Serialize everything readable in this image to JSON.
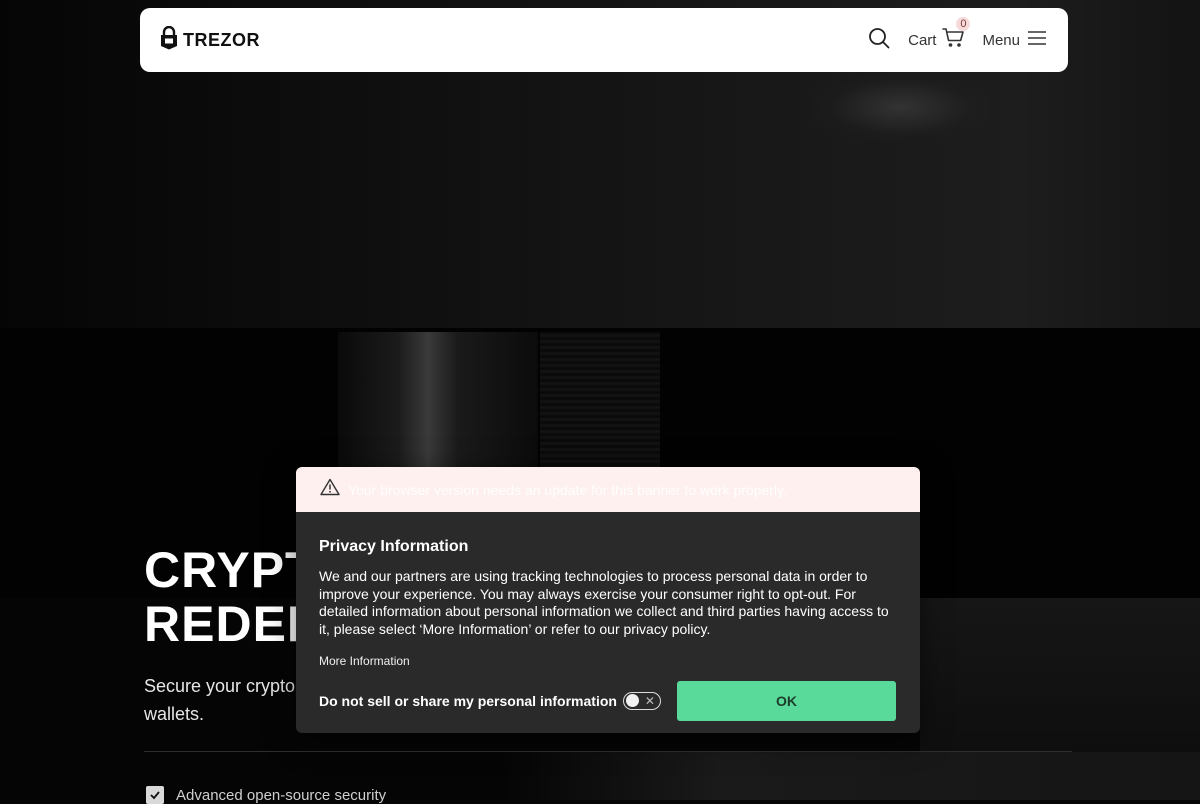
{
  "header": {
    "logo_text": "TREZOR",
    "cart_label": "Cart",
    "cart_count": "0",
    "menu_label": "Menu"
  },
  "hero": {
    "title_line1": "CRYPT",
    "title_line2": "REDEF",
    "subtitle_line1": "Secure your crypto",
    "subtitle_line2": "wallets.",
    "feature_1": "Advanced open-source security"
  },
  "privacy_modal": {
    "warning": "Your browser version needs an update for this banner to work properly.",
    "title": "Privacy Information",
    "description": "We and our partners are using tracking technologies to process personal data in order to improve your experience. You may always exercise your consumer right to opt-out. For detailed information about personal information we collect and third parties having access to it, please select ‘More Information’ or refer to our privacy policy.",
    "more_info": "More Information",
    "do_not_sell_label": "Do not sell or share my personal information",
    "toggle_state": "off",
    "ok_label": "OK"
  },
  "colors": {
    "accent_green": "#59d99a",
    "modal_bg": "#2a2a2a",
    "warning_bg": "#fdf0ee"
  }
}
